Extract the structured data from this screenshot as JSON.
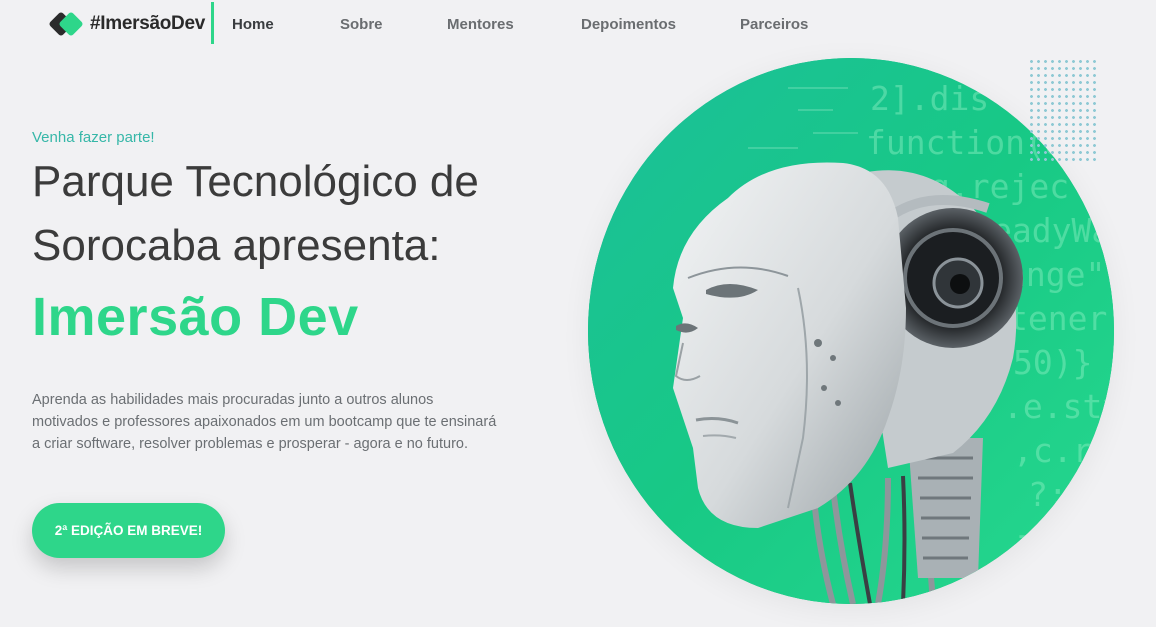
{
  "nav": {
    "logo_text": "#ImersãoDev",
    "links": [
      {
        "label": "Home",
        "active": true
      },
      {
        "label": "Sobre",
        "active": false
      },
      {
        "label": "Mentores",
        "active": false
      },
      {
        "label": "Depoimentos",
        "active": false
      },
      {
        "label": "Parceiros",
        "active": false
      }
    ]
  },
  "hero": {
    "eyebrow": "Venha fazer parte!",
    "headline_line1": "Parque Tecnológico de",
    "headline_line2": "Sorocaba apresenta:",
    "highlight": "Imersão Dev",
    "description": "Aprenda as habilidades mais procuradas junto a outros alunos motivados e professores apaixonados em um bootcamp que te ensinará a criar software, resolver problemas e prosperar - agora e no futuro.",
    "cta_label": "2ª EDIÇÃO EM BREVE!",
    "code_lines": [
      "2].dis",
      "function(a",
      "g.rejec",
      "eadyWa",
      "ange\"",
      "tener",
      "50)}",
      ".e.sty",
      ",c.rem",
      "?:\\",
      "=>"
    ]
  },
  "colors": {
    "accent": "#2ed68a",
    "eyebrow": "#36b7a8",
    "text_dark": "#3b3b3b",
    "text_muted": "#6b6f73",
    "background": "#f1f1f3"
  }
}
